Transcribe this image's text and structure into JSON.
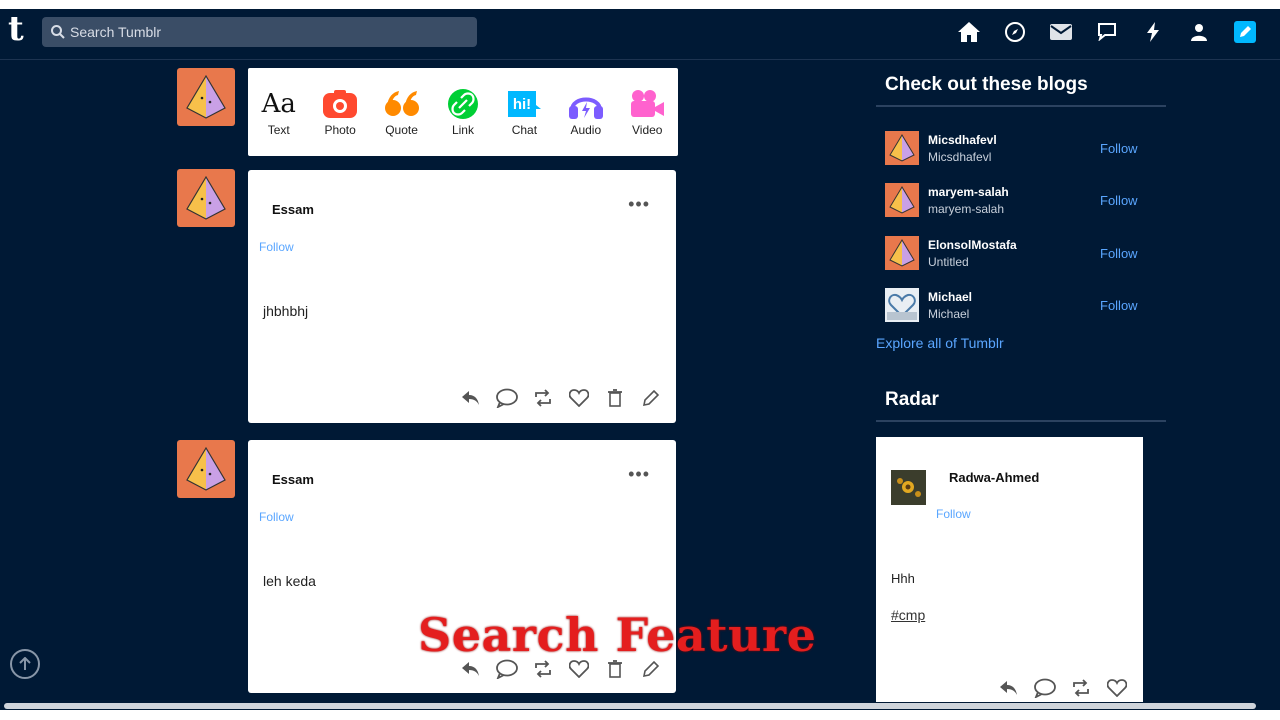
{
  "header": {
    "logo": "t",
    "search_placeholder": "Search Tumblr",
    "nav_icons": [
      "home-icon",
      "explore-compass-icon",
      "mail-icon",
      "chat-icon",
      "lightning-icon",
      "account-icon",
      "compose-pen-icon"
    ]
  },
  "composer": {
    "types": [
      {
        "label": "Text",
        "icon": "text-icon",
        "glyph": "Aa",
        "color": "#111111"
      },
      {
        "label": "Photo",
        "icon": "camera-icon",
        "color": "#ff492f"
      },
      {
        "label": "Quote",
        "icon": "quote-icon",
        "color": "#ff8a00"
      },
      {
        "label": "Link",
        "icon": "link-icon",
        "color": "#00cf35"
      },
      {
        "label": "Chat",
        "icon": "chat-hi-icon",
        "glyph": "hi!",
        "color": "#00b8ff"
      },
      {
        "label": "Audio",
        "icon": "headphones-icon",
        "color": "#7c5cff"
      },
      {
        "label": "Video",
        "icon": "video-camera-icon",
        "color": "#ff62ce"
      }
    ]
  },
  "posts": [
    {
      "author": "Essam",
      "follow": "Follow",
      "body": "jhbhbhj"
    },
    {
      "author": "Essam",
      "follow": "Follow",
      "body": "leh keda"
    }
  ],
  "sidebar": {
    "blogs_heading": "Check out these blogs",
    "blogs": [
      {
        "name": "Micsdhafevl",
        "subtitle": "Micsdhafevl",
        "follow": "Follow"
      },
      {
        "name": "maryem-salah",
        "subtitle": "maryem-salah",
        "follow": "Follow"
      },
      {
        "name": "ElonsolMostafa",
        "subtitle": "Untitled",
        "follow": "Follow"
      },
      {
        "name": "Michael",
        "subtitle": "Michael",
        "follow": "Follow"
      }
    ],
    "explore_link": "Explore all of Tumblr",
    "radar_heading": "Radar",
    "radar": {
      "name": "Radwa-Ahmed",
      "follow": "Follow",
      "body": "Hhh",
      "tag": "#cmp"
    }
  },
  "overlay_caption": "Search Feature",
  "colors": {
    "background": "#001935",
    "accent_link": "#5aa6ff",
    "avatar_orange": "#e8784c",
    "caption_red": "#e41e1e",
    "compose_blue": "#00b8ff"
  }
}
